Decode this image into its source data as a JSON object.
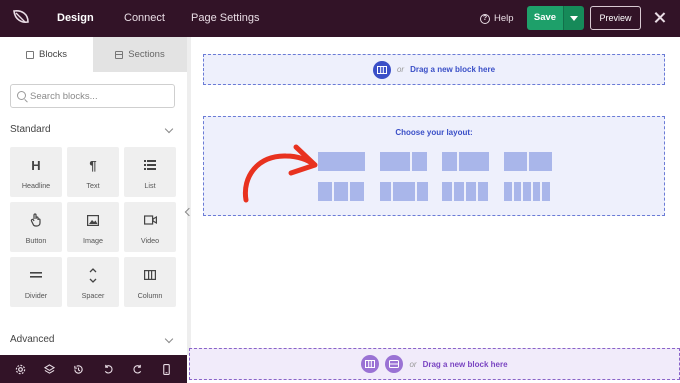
{
  "topbar": {
    "logo_icon": "seedprod-leaf-icon",
    "tabs": [
      {
        "label": "Design",
        "active": true
      },
      {
        "label": "Connect",
        "active": false
      },
      {
        "label": "Page Settings",
        "active": false
      }
    ],
    "help_label": "Help",
    "save_label": "Save",
    "preview_label": "Preview"
  },
  "sidebar": {
    "tabs": [
      {
        "label": "Blocks",
        "icon": "blocks-icon",
        "active": true
      },
      {
        "label": "Sections",
        "icon": "sections-icon",
        "active": false
      }
    ],
    "search_placeholder": "Search blocks...",
    "groups": [
      {
        "label": "Standard",
        "expanded": true
      },
      {
        "label": "Advanced",
        "expanded": false
      }
    ],
    "blocks": [
      {
        "label": "Headline",
        "icon": "H"
      },
      {
        "label": "Text",
        "icon": "¶"
      },
      {
        "label": "List",
        "icon": "list-icon"
      },
      {
        "label": "Button",
        "icon": "pointer-hand-icon"
      },
      {
        "label": "Image",
        "icon": "image-icon"
      },
      {
        "label": "Video",
        "icon": "video-icon"
      },
      {
        "label": "Divider",
        "icon": "divider-icon"
      },
      {
        "label": "Spacer",
        "icon": "spacer-icon"
      },
      {
        "label": "Column",
        "icon": "columns-icon"
      }
    ]
  },
  "bottom_toolbar": [
    "settings-gear-icon",
    "layers-icon",
    "history-icon",
    "undo-icon",
    "redo-icon",
    "mobile-preview-icon"
  ],
  "canvas": {
    "top_dropzone": {
      "or": "or",
      "link": "Drag a new block here"
    },
    "layout_chooser": {
      "title": "Choose your layout:",
      "options": [
        {
          "columns": 1
        },
        {
          "columns": 2
        },
        {
          "columns": 2
        },
        {
          "columns": 2
        },
        {
          "columns": 3
        },
        {
          "columns": 3
        },
        {
          "columns": 4
        },
        {
          "columns": 5
        }
      ]
    },
    "bottom_dropzone": {
      "or": "or",
      "link": "Drag a new block here"
    }
  },
  "colors": {
    "topbar": "#321327",
    "save_green": "#1ea06a",
    "accent_blue": "#3a4fc7",
    "accent_purple": "#7a45c2",
    "annotation_red": "#e8321f"
  }
}
